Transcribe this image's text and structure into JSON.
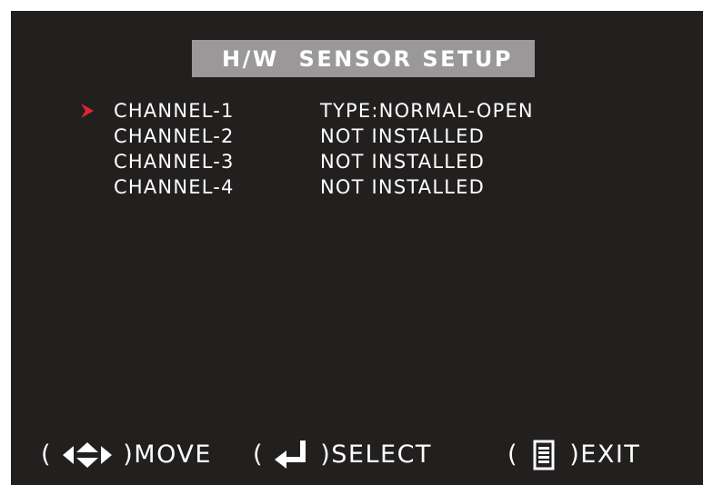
{
  "menu": {
    "title": "H/W  SENSOR SETUP",
    "channels": [
      {
        "label": "CHANNEL-1",
        "status": "TYPE:NORMAL-OPEN",
        "selected": true
      },
      {
        "label": "CHANNEL-2",
        "status": "NOT INSTALLED",
        "selected": false
      },
      {
        "label": "CHANNEL-3",
        "status": "NOT INSTALLED",
        "selected": false
      },
      {
        "label": "CHANNEL-4",
        "status": "NOT INSTALLED",
        "selected": false
      }
    ]
  },
  "footer": {
    "move": {
      "icon": "arrow-keys-icon",
      "label": "MOVE"
    },
    "select": {
      "icon": "enter-icon",
      "label": "SELECT"
    },
    "exit": {
      "icon": "menu-icon",
      "label": "EXIT"
    },
    "paren_open": "(",
    "paren_close": ")"
  },
  "colors": {
    "background": "#221f1f",
    "title_bar": "#9a9898",
    "text": "#ffffff",
    "cursor": "#e0262e"
  }
}
